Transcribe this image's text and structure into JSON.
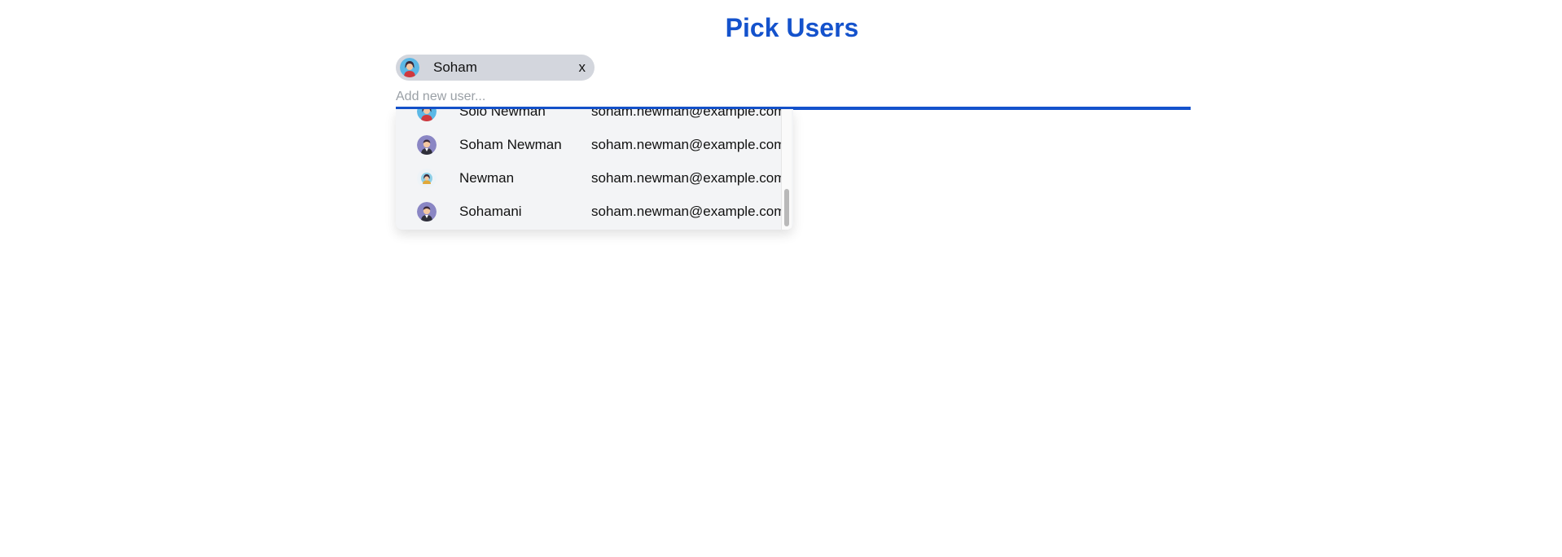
{
  "page": {
    "title": "Pick Users"
  },
  "selected_chip": {
    "label": "Soham",
    "close_label": "x",
    "avatar_icon": "woman-avatar-icon"
  },
  "input": {
    "value": "",
    "placeholder": "Add new user..."
  },
  "dropdown": {
    "items": [
      {
        "name": "Solo Newman",
        "email": "soham.newman@example.com",
        "avatar_icon": "woman-avatar-icon"
      },
      {
        "name": "Soham Newman",
        "email": "soham.newman@example.com",
        "avatar_icon": "man-avatar-icon"
      },
      {
        "name": "Newman",
        "email": "soham.newman@example.com",
        "avatar_icon": "woman-avatar-icon"
      },
      {
        "name": "Sohamani",
        "email": "soham.newman@example.com",
        "avatar_icon": "man-avatar-icon"
      }
    ]
  },
  "colors": {
    "accent": "#1452cc",
    "chip_bg": "#d3d6dd",
    "dropdown_bg": "#f3f4f6"
  }
}
